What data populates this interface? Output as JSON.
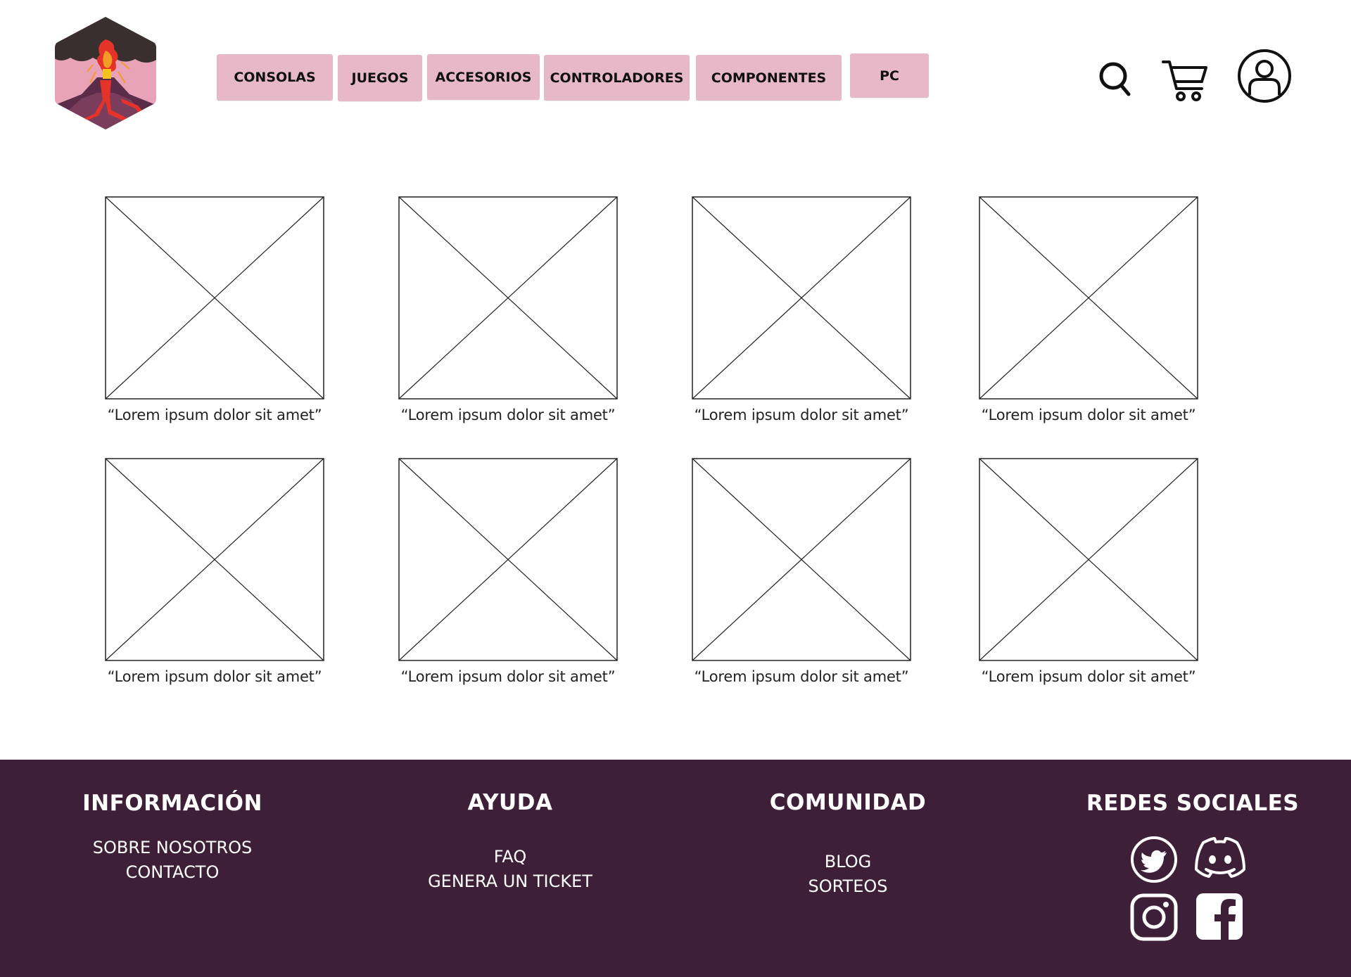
{
  "header": {
    "logo_name": "volcano-logo",
    "nav": [
      {
        "label": "CONSOLAS"
      },
      {
        "label": "JUEGOS"
      },
      {
        "label": "ACCESORIOS"
      },
      {
        "label": "CONTROLADORES"
      },
      {
        "label": "COMPONENTES"
      },
      {
        "label": "PC"
      }
    ],
    "icons": [
      "search-icon",
      "cart-icon",
      "user-icon"
    ]
  },
  "products": [
    {
      "caption": "“Lorem ipsum dolor sit amet”"
    },
    {
      "caption": "“Lorem ipsum dolor sit amet”"
    },
    {
      "caption": "“Lorem ipsum dolor sit amet”"
    },
    {
      "caption": "“Lorem ipsum dolor sit amet”"
    },
    {
      "caption": "“Lorem ipsum dolor sit amet”"
    },
    {
      "caption": "“Lorem ipsum dolor sit amet”"
    },
    {
      "caption": "“Lorem ipsum dolor sit amet”"
    },
    {
      "caption": "“Lorem ipsum dolor sit amet”"
    }
  ],
  "footer": {
    "info": {
      "title": "INFORMACIÓN",
      "links": [
        "SOBRE NOSOTROS",
        "CONTACTO"
      ]
    },
    "help": {
      "title": "AYUDA",
      "links": [
        "FAQ",
        "GENERA UN TICKET"
      ]
    },
    "community": {
      "title": "COMUNIDAD",
      "links": [
        "BLOG",
        "SORTEOS"
      ]
    },
    "social": {
      "title": "REDES SOCIALES",
      "icons": [
        "twitter-icon",
        "discord-icon",
        "instagram-icon",
        "facebook-icon"
      ]
    }
  },
  "colors": {
    "nav_button": "#e6b8c8",
    "footer_bg": "#3d1f37",
    "logo_pink": "#e8a3b8",
    "logo_dark": "#3a2f2f",
    "lava": "#e5332a"
  }
}
